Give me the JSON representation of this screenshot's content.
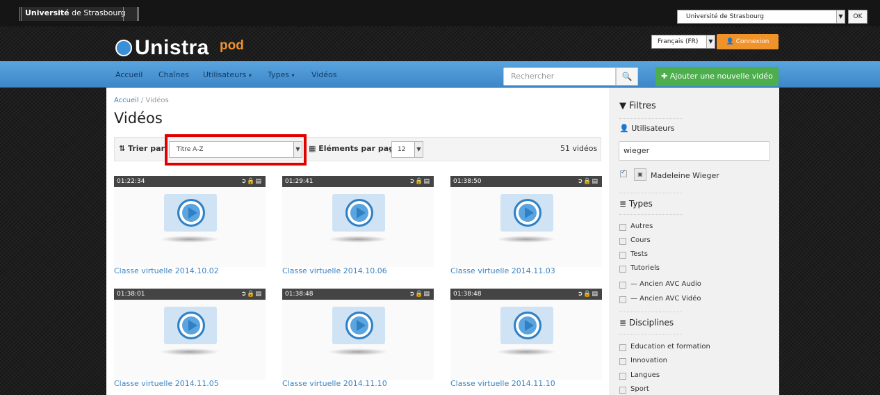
{
  "topbar": {
    "university_logo_bold": "Université",
    "university_logo_rest": " de Strasbourg",
    "university_select": "Université de Strasbourg",
    "ok_label": "OK"
  },
  "brand": {
    "logo_word": "Unistra",
    "logo_suffix": "pod",
    "language_select": "Français (FR)",
    "login_label": "Connexion"
  },
  "nav": {
    "items": [
      {
        "label": "Accueil"
      },
      {
        "label": "Chaînes"
      },
      {
        "label": "Utilisateurs"
      },
      {
        "label": "Types"
      },
      {
        "label": "Vidéos"
      }
    ],
    "search_placeholder": "Rechercher",
    "add_video_label": "Ajouter une nouvelle vidéo"
  },
  "main": {
    "breadcrumb": [
      "Accueil",
      "Vidéos"
    ],
    "title": "Vidéos",
    "sort_label": "Trier par",
    "sort_value": "Titre A-Z",
    "per_page_label": "Eléments par page",
    "per_page_value": "12",
    "video_count": "51 vidéos",
    "videos": [
      {
        "duration": "01:22:34",
        "title": "Classe virtuelle 2014.10.02"
      },
      {
        "duration": "01:29:41",
        "title": "Classe virtuelle 2014.10.06"
      },
      {
        "duration": "01:38:50",
        "title": "Classe virtuelle 2014.11.03"
      },
      {
        "duration": "01:38:01",
        "title": "Classe virtuelle 2014.11.05"
      },
      {
        "duration": "01:38:48",
        "title": "Classe virtuelle 2014.11.10"
      },
      {
        "duration": "01:38:48",
        "title": "Classe virtuelle 2014.11.10"
      }
    ]
  },
  "sidebar": {
    "filters_title": "Filtres",
    "users_title": "Utilisateurs",
    "user_search_value": "wieger",
    "users": [
      {
        "name": "Madeleine Wieger",
        "checked": true
      }
    ],
    "types_title": "Types",
    "types": [
      "Autres",
      "Cours",
      "Tests",
      "Tutoriels",
      "— Ancien AVC Audio",
      "— Ancien AVC Vidéo"
    ],
    "disciplines_title": "Disciplines",
    "disciplines": [
      "Education et formation",
      "Innovation",
      "Langues",
      "Sport"
    ]
  },
  "colors": {
    "nav_blue": "#3d87c9",
    "accent_orange": "#f0932b",
    "add_green": "#4cae4c",
    "link_blue": "#3b82c4",
    "highlight_red": "#e00000"
  }
}
